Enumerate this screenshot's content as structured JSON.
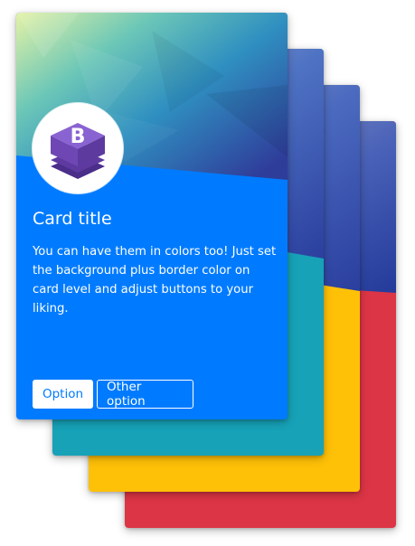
{
  "colors": {
    "blue": "#007bff",
    "teal": "#17a2b8",
    "yellow": "#ffc107",
    "red": "#dc3545",
    "logo_purple": "#7952b3"
  },
  "logo": {
    "letter": "B",
    "icon": "bootstrap-logo-icon"
  },
  "card": {
    "title": "Card title",
    "text": "You can have them in colors too! Just set the background plus border color on card level and adjust buttons to your liking.",
    "primary_button": "Option",
    "secondary_button": "Other option"
  }
}
